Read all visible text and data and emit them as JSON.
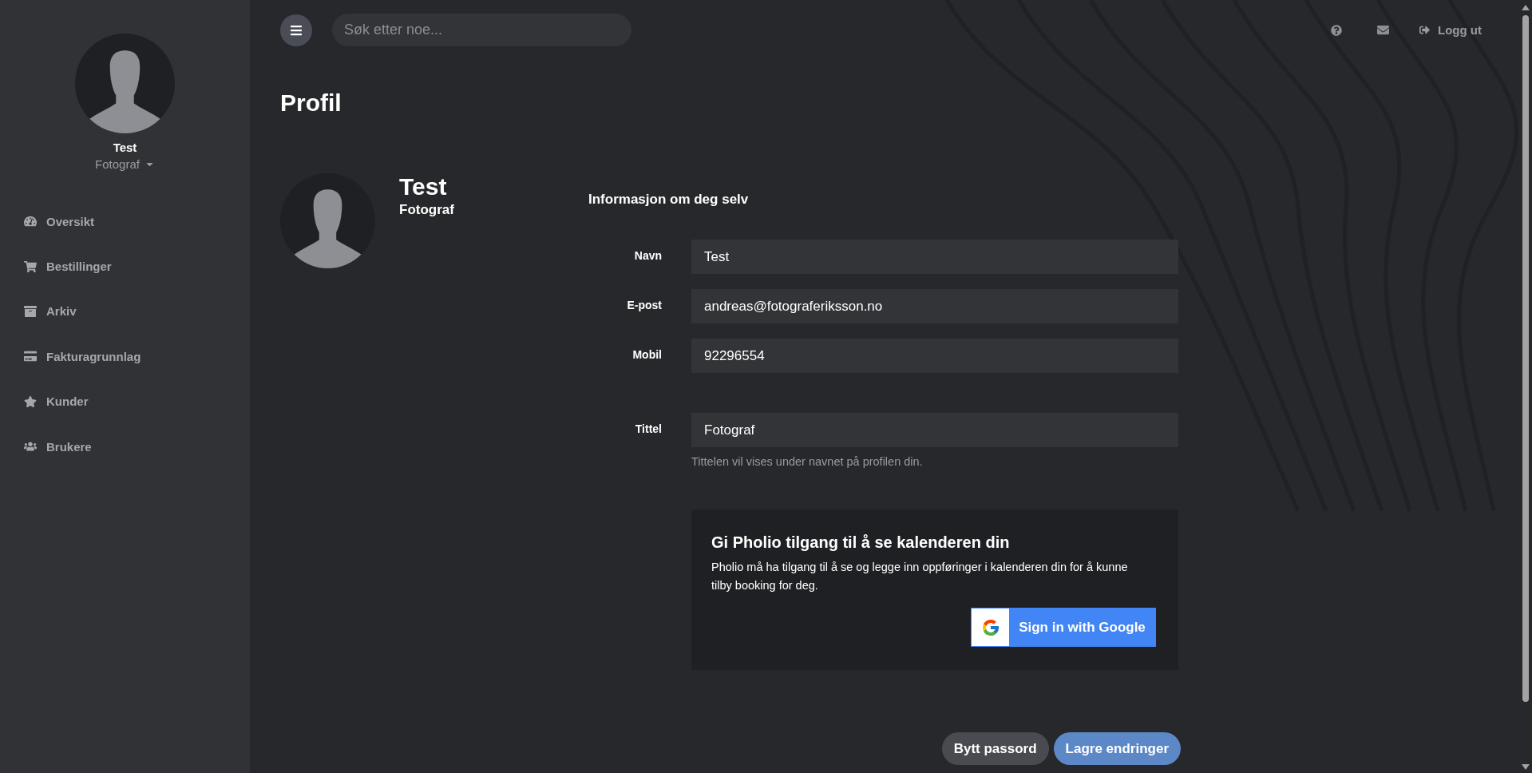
{
  "sidebar": {
    "user": {
      "name": "Test",
      "role": "Fotograf"
    },
    "items": [
      {
        "kind": "dashboard",
        "label": "Oversikt"
      },
      {
        "kind": "cart",
        "label": "Bestillinger"
      },
      {
        "kind": "archive",
        "label": "Arkiv"
      },
      {
        "kind": "card",
        "label": "Fakturagrunnlag"
      },
      {
        "kind": "star",
        "label": "Kunder"
      },
      {
        "kind": "users",
        "label": "Brukere"
      }
    ]
  },
  "topbar": {
    "search": {
      "placeholder": "Søk etter noe..."
    },
    "logout": "Logg ut"
  },
  "page": {
    "title": "Profil",
    "profile": {
      "name": "Test",
      "title": "Fotograf"
    },
    "section_title": "Informasjon om deg selv",
    "fields": [
      {
        "label": "Navn",
        "value": "Test"
      },
      {
        "label": "E-post",
        "value": "andreas@fotograferiksson.no"
      },
      {
        "label": "Mobil",
        "value": "92296554"
      },
      {
        "label": "Tittel",
        "value": "Fotograf",
        "hint": "Tittelen vil vises under navnet på profilen din."
      }
    ],
    "calendar": {
      "title": "Gi Pholio tilgang til å se kalenderen din",
      "text": "Pholio må ha tilgang til å se og legge inn oppføringer i kalenderen din for å kunne tilby booking for deg.",
      "button": "Sign in with Google"
    },
    "buttons": [
      {
        "kind": "secondary",
        "label": "Bytt passord"
      },
      {
        "kind": "primary",
        "label": "Lagre endringer"
      }
    ]
  }
}
